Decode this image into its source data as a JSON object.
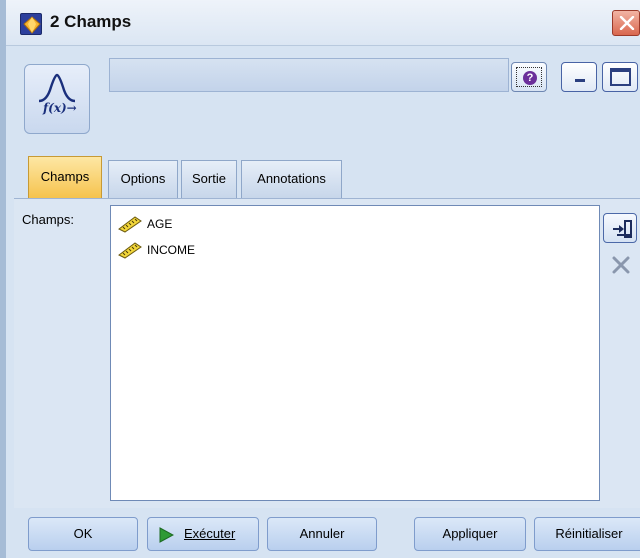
{
  "window": {
    "title": "2 Champs",
    "title_icon": "diamond-node-icon",
    "close_icon": "close-icon"
  },
  "header": {
    "node_icon": "fx-node-icon",
    "node_icon_text": "f(x)→",
    "name_value": "",
    "help_icon": "help-icon",
    "minimize_icon": "minimize-icon",
    "maximize_icon": "maximize-icon"
  },
  "tabs": [
    {
      "label": "Champs",
      "active": true
    },
    {
      "label": "Options",
      "active": false
    },
    {
      "label": "Sortie",
      "active": false
    },
    {
      "label": "Annotations",
      "active": false
    }
  ],
  "content": {
    "fields_label": "Champs:",
    "fields": [
      {
        "name": "AGE",
        "icon": "continuous-ruler-icon"
      },
      {
        "name": "INCOME",
        "icon": "continuous-ruler-icon"
      }
    ],
    "add_icon": "field-picker-icon",
    "remove_icon": "delete-x-icon"
  },
  "buttons": {
    "ok": "OK",
    "run": "Exécuter",
    "cancel": "Annuler",
    "apply": "Appliquer",
    "reset": "Réinitialiser"
  },
  "colors": {
    "active_tab": "#f6c34d",
    "window_bg": "#d6e3f2",
    "button_bg": "#b9cfee",
    "close_btn": "#d9674e"
  }
}
